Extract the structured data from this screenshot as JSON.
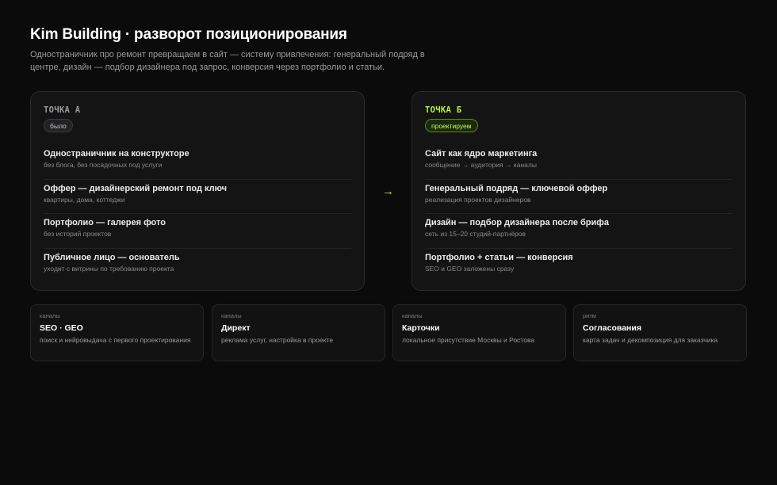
{
  "header": {
    "title": "Kim Building · разворот позиционирования",
    "subtitle": "Одностраничник про ремонт превращаем в сайт — систему привлечения: генеральный подряд в центре, дизайн — подбор дизайнера под запрос, конверсия через портфолио и статьи."
  },
  "point_a": {
    "label": "ТОЧКА А",
    "badge": "было",
    "items": [
      {
        "title": "Одностраничник на конструкторе",
        "sub": "без блога, без посадочных под услуги"
      },
      {
        "title": "Оффер — дизайнерский ремонт под ключ",
        "sub": "квартиры, дома, коттеджи"
      },
      {
        "title": "Портфолио — галерея фото",
        "sub": "без историй проектов"
      },
      {
        "title": "Публичное лицо — основатель",
        "sub": "уходит с витрины по требованию проекта"
      }
    ]
  },
  "arrow": "→",
  "point_b": {
    "label": "ТОЧКА Б",
    "badge": "проектируем",
    "items": [
      {
        "title": "Сайт как ядро маркетинга",
        "sub": "сообщение → аудитория → каналы"
      },
      {
        "title": "Генеральный подряд — ключевой оффер",
        "sub": "реализация проектов дизайнеров"
      },
      {
        "title": "Дизайн — подбор дизайнера после брифа",
        "sub": "сеть из 15–20 студий-партнёров"
      },
      {
        "title": "Портфолио + статьи — конверсия",
        "sub": "SEO и GEO заложены сразу"
      }
    ]
  },
  "tiles": [
    {
      "kicker": "каналы",
      "title": "SEO · GEO",
      "sub": "поиск и нейровыдача с первого проектирования"
    },
    {
      "kicker": "каналы",
      "title": "Директ",
      "sub": "реклама услуг, настройка в проекте"
    },
    {
      "kicker": "каналы",
      "title": "Карточки",
      "sub": "локальное присутствие Москвы и Ростова"
    },
    {
      "kicker": "ритм",
      "title": "Согласования",
      "sub": "карта задач и декомпозиция для заказчика"
    }
  ],
  "colors": {
    "accent": "#b6f23a",
    "background": "#0b0b0c",
    "card": "#141415"
  }
}
